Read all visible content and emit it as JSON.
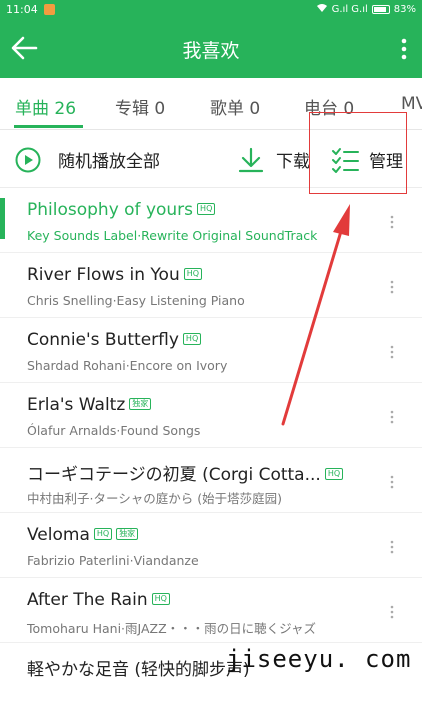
{
  "status": {
    "time": "11:04",
    "signal": "G.ıl G.ıl",
    "battery": "83%"
  },
  "header": {
    "title": "我喜欢"
  },
  "tabs": [
    {
      "label": "单曲 26"
    },
    {
      "label": "专辑 0"
    },
    {
      "label": "歌单 0"
    },
    {
      "label": "电台 0"
    },
    {
      "label": "MV"
    }
  ],
  "actions": {
    "shuffle": "随机播放全部",
    "download": "下载",
    "manage": "管理"
  },
  "songs": [
    {
      "title": "Philosophy of yours",
      "badges": [
        "HQ"
      ],
      "meta": "Key Sounds Label·Rewrite Original SoundTrack"
    },
    {
      "title": "River Flows in You",
      "badges": [
        "HQ"
      ],
      "meta": "Chris Snelling·Easy Listening Piano"
    },
    {
      "title": "Connie's Butterfly",
      "badges": [
        "HQ"
      ],
      "meta": "Shardad Rohani·Encore on Ivory"
    },
    {
      "title": "Erla's Waltz",
      "badges": [
        "独家"
      ],
      "meta": "Ólafur Arnalds·Found Songs"
    },
    {
      "title": "コーギコテージの初夏 (Corgi Cotta...",
      "badges": [
        "HQ"
      ],
      "meta": "中村由利子·ターシャの庭から (始于塔莎庭园)"
    },
    {
      "title": "Veloma",
      "badges": [
        "HQ",
        "独家"
      ],
      "meta": "Fabrizio Paterlini·Viandanze"
    },
    {
      "title": "After The Rain",
      "badges": [
        "HQ"
      ],
      "meta": "Tomoharu Hani·雨JAZZ・・・雨の日に聴くジャズ"
    },
    {
      "title": "軽やかな足音 (轻快的脚步声)",
      "badges": [],
      "meta": ""
    }
  ],
  "watermark": "jiseeyu. com",
  "colors": {
    "accent": "#27b35a",
    "annotation": "#e23b3b"
  }
}
